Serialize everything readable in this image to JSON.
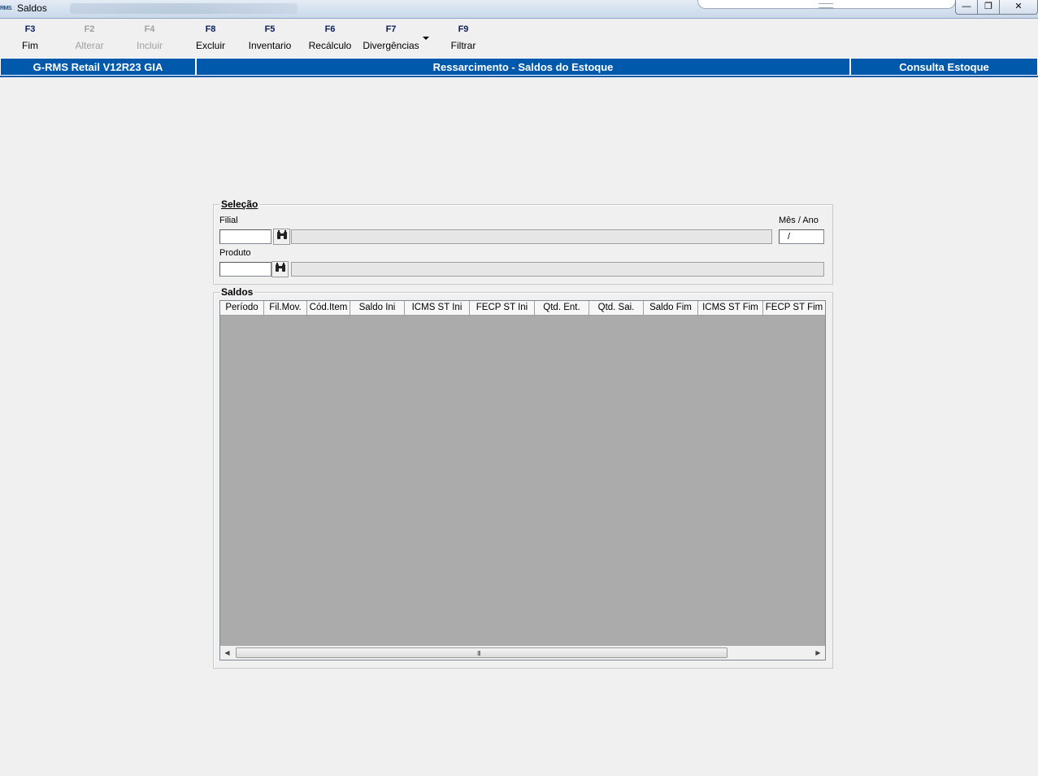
{
  "window": {
    "app_icon_text": "RMS",
    "title": "Saldos",
    "controls": {
      "minimize": "—",
      "maximize": "❐",
      "close": "✕"
    }
  },
  "toolbar": {
    "items": [
      {
        "key": "F3",
        "label": "Fim",
        "enabled": true
      },
      {
        "key": "F2",
        "label": "Alterar",
        "enabled": false
      },
      {
        "key": "F4",
        "label": "Incluir",
        "enabled": false
      },
      {
        "key": "F8",
        "label": "Excluir",
        "enabled": true
      },
      {
        "key": "F5",
        "label": "Inventario",
        "enabled": true
      },
      {
        "key": "F6",
        "label": "Recálculo",
        "enabled": true
      },
      {
        "key": "F7",
        "label": "Divergências",
        "enabled": true
      },
      {
        "key": "F9",
        "label": "Filtrar",
        "enabled": true
      }
    ]
  },
  "infobar": {
    "system": "G-RMS Retail V12R23 GIA",
    "screen_title": "Ressarcimento - Saldos do Estoque",
    "mode": "Consulta Estoque",
    "color": "#0059ab"
  },
  "selecao": {
    "title": "Seleção",
    "filial_label": "Filial",
    "filial_value": "",
    "mes_ano_label": "Mês / Ano",
    "mes_ano_value": "/",
    "produto_label": "Produto",
    "produto_value": ""
  },
  "saldos": {
    "title": "Saldos",
    "columns": [
      "Período",
      "Fil.Mov.",
      "Cód.Item",
      "Saldo Ini",
      "ICMS ST Ini",
      "FECP ST Ini",
      "Qtd. Ent.",
      "Qtd. Sai.",
      "Saldo Fim",
      "ICMS ST Fim",
      "FECP ST Fim"
    ],
    "rows": [],
    "scroll_grip": "III"
  }
}
